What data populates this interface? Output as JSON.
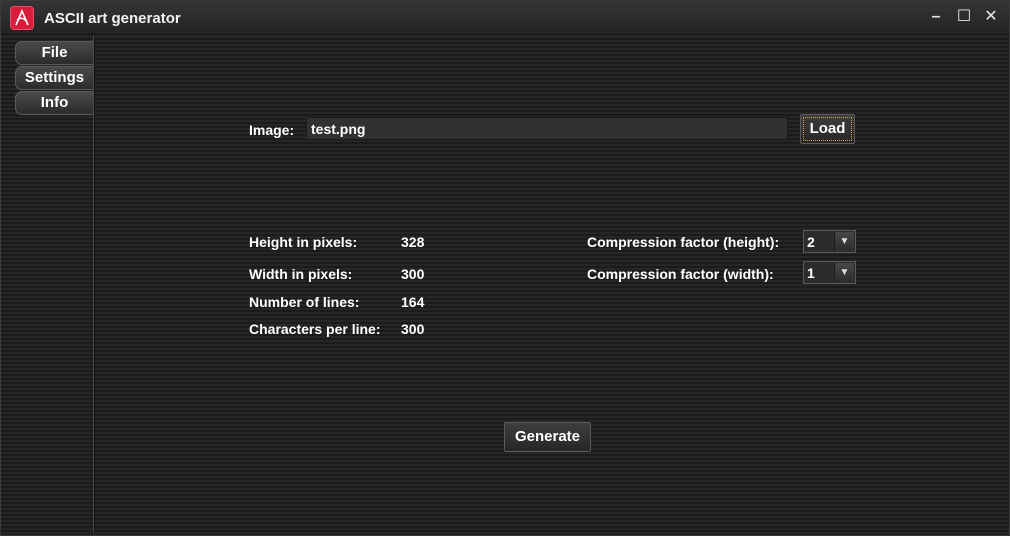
{
  "window": {
    "title": "ASCII art generator",
    "controls": {
      "minimize": "–",
      "maximize": "☐",
      "close": "✕"
    },
    "icon": "app-logo-icon",
    "accent": "#d81c3c"
  },
  "sidebar": {
    "items": [
      {
        "label": "File"
      },
      {
        "label": "Settings"
      },
      {
        "label": "Info"
      }
    ]
  },
  "image_row": {
    "label": "Image:",
    "value": "test.png",
    "load_label": "Load"
  },
  "stats": {
    "height_label": "Height in pixels:",
    "height_value": "328",
    "width_label": "Width in pixels:",
    "width_value": "300",
    "lines_label": "Number of lines:",
    "lines_value": "164",
    "chars_label": "Characters per line:",
    "chars_value": "300"
  },
  "compression": {
    "height_label": "Compression factor (height):",
    "height_value": "2",
    "width_label": "Compression factor (width):",
    "width_value": "1"
  },
  "generate_label": "Generate"
}
